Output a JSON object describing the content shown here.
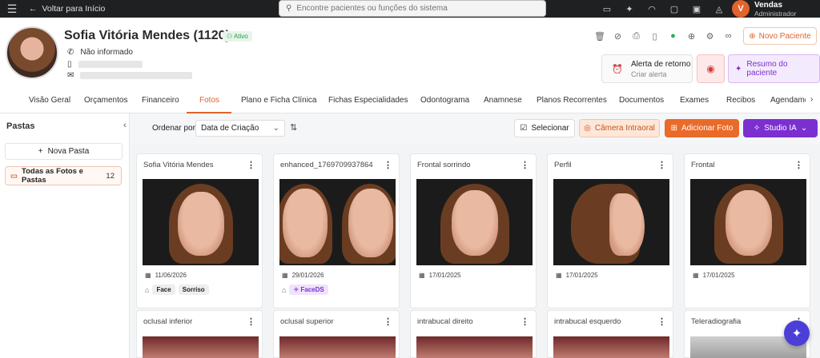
{
  "topbar": {
    "back_label": "Voltar para Início",
    "search_placeholder": "Encontre pacientes ou funções do sistema",
    "user_initial": "V",
    "user_name": "Vendas",
    "user_role": "Administrador"
  },
  "patient": {
    "name": "Sofia Vitória Mendes (1120)",
    "status": "Ativo",
    "phone": "Não informado"
  },
  "header_actions": {
    "new_patient": "Novo Paciente",
    "alert_title": "Alerta de retorno",
    "alert_sub": "Criar alerta",
    "summary": "Resumo do paciente"
  },
  "tabs": [
    "Visão Geral",
    "Orçamentos",
    "Financeiro",
    "Fotos",
    "Plano e Ficha Clínica",
    "Fichas Especialidades",
    "Odontograma",
    "Anamnese",
    "Planos Recorrentes",
    "Documentos",
    "Exames",
    "Recibos",
    "Agendamentos"
  ],
  "folders": {
    "title": "Pastas",
    "new_folder": "Nova Pasta",
    "all_label": "Todas as Fotos e Pastas",
    "all_count": "12"
  },
  "toolbar": {
    "sort_label": "Ordenar por",
    "sort_value": "Data de Criação",
    "select": "Selecionar",
    "camera": "Câmera Intraoral",
    "add_photo": "Adicionar Foto",
    "studio": "Studio IA"
  },
  "photos": [
    {
      "name": "Sofia Vitória Mendes",
      "date": "11/06/2026",
      "tags": [
        "Face",
        "Sorriso"
      ]
    },
    {
      "name": "enhanced_1769709937864",
      "date": "29/01/2026",
      "tags": [
        "FaceDS"
      ]
    },
    {
      "name": "Frontal sorrindo",
      "date": "17/01/2025",
      "tags": []
    },
    {
      "name": "Perfil",
      "date": "17/01/2025",
      "tags": []
    },
    {
      "name": "Frontal",
      "date": "17/01/2025",
      "tags": []
    }
  ],
  "photos_row2": [
    "oclusal inferior",
    "oclusal superior",
    "intrabucal direito",
    "intrabucal esquerdo",
    "Teleradiografia"
  ]
}
